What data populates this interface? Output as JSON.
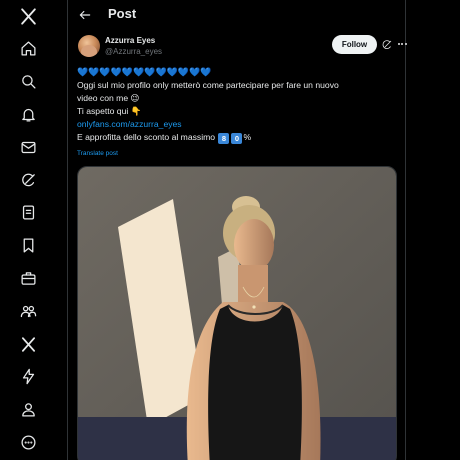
{
  "header": {
    "title": "Post"
  },
  "nav": {
    "items": [
      {
        "name": "x-logo-icon"
      },
      {
        "name": "home-icon"
      },
      {
        "name": "search-icon"
      },
      {
        "name": "notifications-icon"
      },
      {
        "name": "messages-icon"
      },
      {
        "name": "grok-icon"
      },
      {
        "name": "lists-icon"
      },
      {
        "name": "bookmarks-icon"
      },
      {
        "name": "jobs-icon"
      },
      {
        "name": "communities-icon"
      },
      {
        "name": "premium-icon"
      },
      {
        "name": "verified-orgs-icon"
      },
      {
        "name": "profile-icon"
      },
      {
        "name": "more-icon"
      }
    ]
  },
  "post": {
    "author_name": "Azzurra Eyes",
    "author_handle": "@Azzurra_eyes",
    "follow_label": "Follow",
    "hearts": "💙💙💙💙💙💙💙💙💙💙💙💙",
    "line1": "Oggi sul mio profilo only metterò come partecipare per fare un nuovo",
    "line2": "video con me 😉",
    "line3": "Ti aspetto qui 👇",
    "link": "onlyfans.com/azzurra_eyes",
    "line5_prefix": "E approfitta dello sconto al massimo ",
    "discount_digit_1": "8",
    "discount_digit_2": "0",
    "line5_suffix": "%",
    "translate_label": "Translate post"
  },
  "colors": {
    "background": "#000000",
    "text": "#e7e9ea",
    "muted": "#71767b",
    "accent": "#1d9bf0"
  }
}
